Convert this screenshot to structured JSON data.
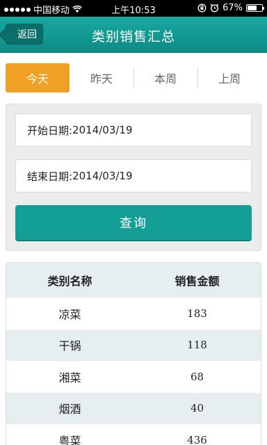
{
  "status_bar": {
    "carrier": "中国移动",
    "time": "上午10:53",
    "battery_percent": "67%",
    "battery_level": 0.67
  },
  "nav": {
    "back_label": "返回",
    "title": "类别销售汇总"
  },
  "tabs": [
    {
      "label": "今天",
      "active": true
    },
    {
      "label": "昨天",
      "active": false
    },
    {
      "label": "本周",
      "active": false
    },
    {
      "label": "上周",
      "active": false
    }
  ],
  "filters": {
    "start_label": "开始日期:",
    "start_value": "2014/03/19",
    "end_label": "结束日期:",
    "end_value": "2014/03/19",
    "query_label": "查询"
  },
  "table": {
    "headers": [
      "类别名称",
      "销售金额"
    ],
    "rows": [
      {
        "category": "凉菜",
        "amount": "183"
      },
      {
        "category": "干锅",
        "amount": "118"
      },
      {
        "category": "湘菜",
        "amount": "68"
      },
      {
        "category": "烟酒",
        "amount": "40"
      },
      {
        "category": "粤菜",
        "amount": "436"
      }
    ]
  },
  "colors": {
    "accent_teal": "#139e96",
    "active_tab": "#f0a024"
  }
}
